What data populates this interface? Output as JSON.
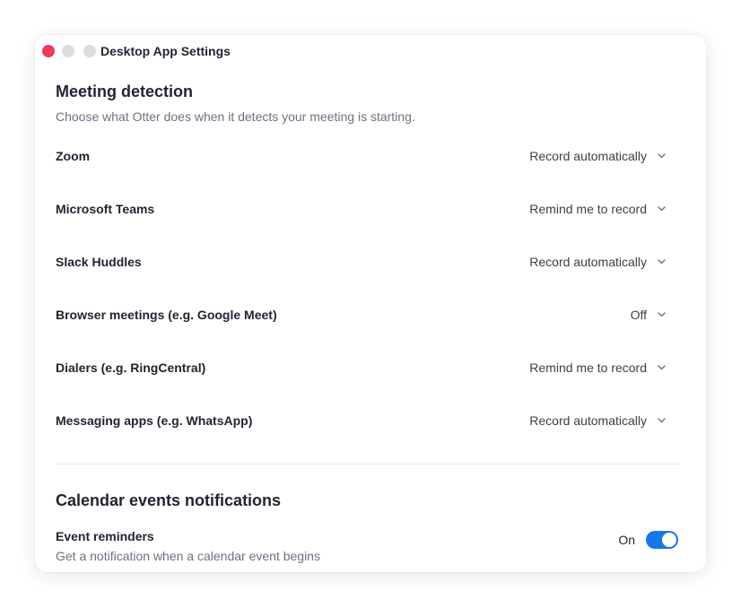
{
  "window": {
    "title": "Desktop App Settings"
  },
  "meeting_detection": {
    "title": "Meeting detection",
    "subtitle": "Choose what Otter does when it detects your meeting is starting.",
    "items": [
      {
        "label": "Zoom",
        "value": "Record automatically"
      },
      {
        "label": "Microsoft Teams",
        "value": "Remind me to record"
      },
      {
        "label": "Slack Huddles",
        "value": "Record automatically"
      },
      {
        "label": "Browser meetings (e.g. Google Meet)",
        "value": "Off"
      },
      {
        "label": "Dialers (e.g. RingCentral)",
        "value": "Remind me to record"
      },
      {
        "label": "Messaging apps (e.g. WhatsApp)",
        "value": "Record automatically"
      }
    ]
  },
  "calendar": {
    "title": "Calendar events notifications",
    "event_reminders": {
      "label": "Event reminders",
      "description": "Get a notification when a calendar event begins",
      "state_label": "On",
      "enabled": true
    }
  },
  "colors": {
    "close_button": "#ee3a55",
    "toggle_on": "#1877e6"
  },
  "icons": {
    "dropdown": "chevron-down-icon"
  }
}
